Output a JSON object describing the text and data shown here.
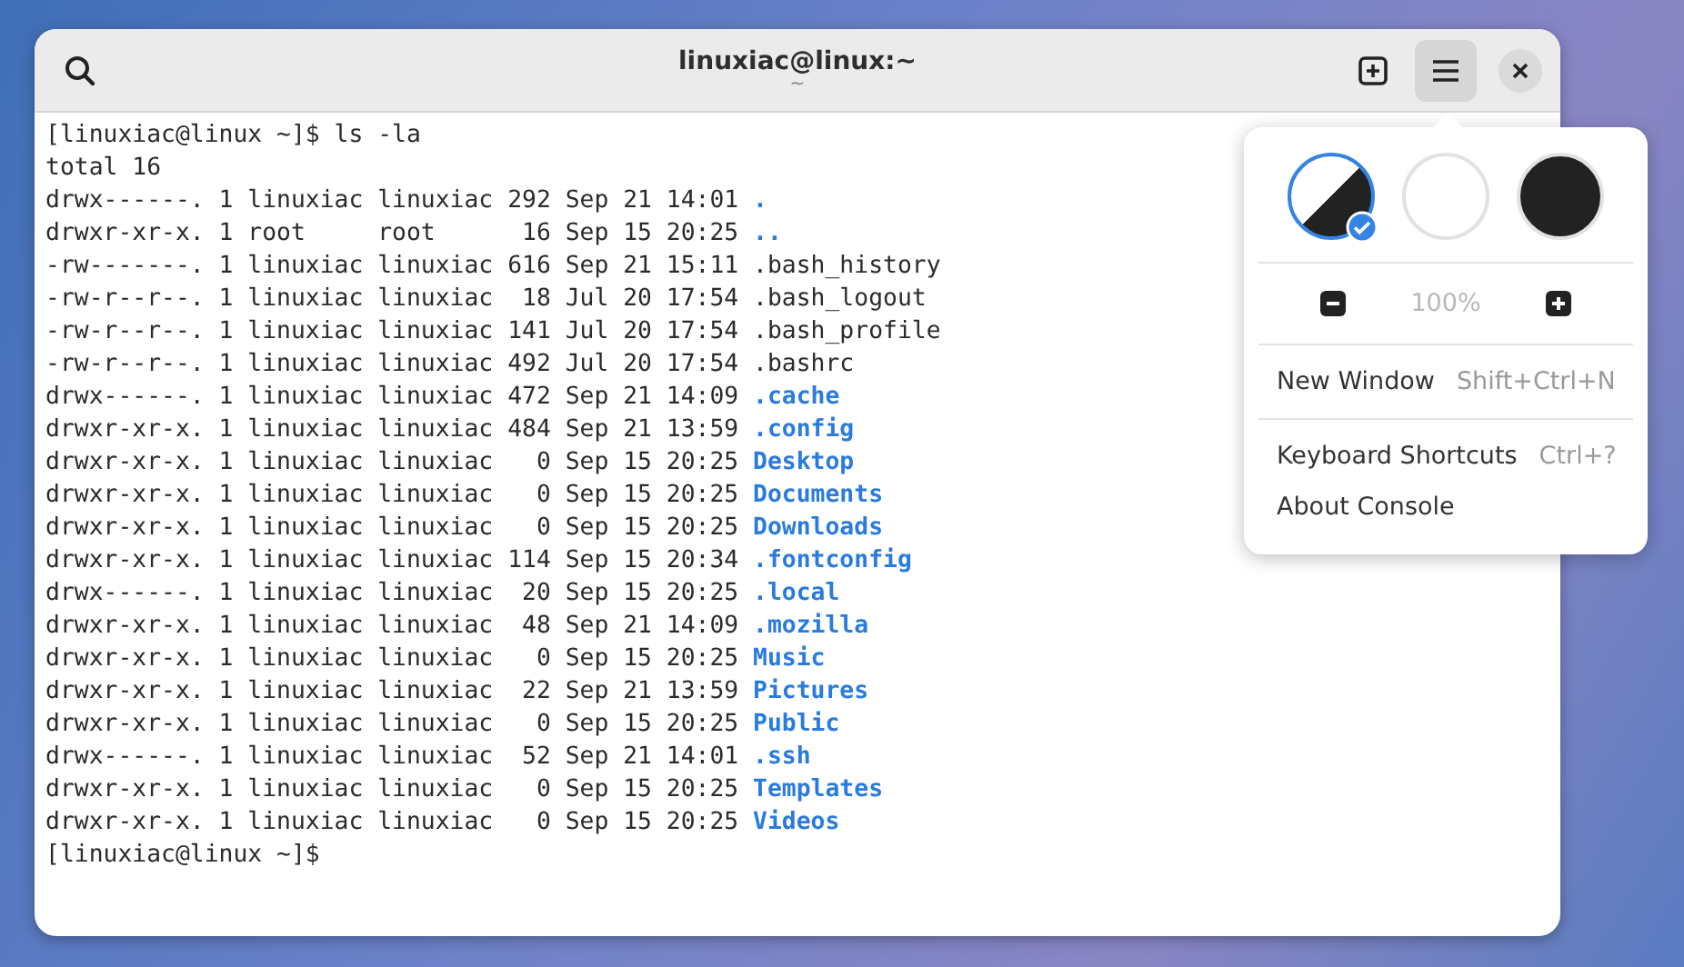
{
  "window": {
    "title": "linuxiac@linux:~",
    "subtitle": "~",
    "menu_open": true
  },
  "terminal": {
    "lines": [
      {
        "kind": "text",
        "text": "[linuxiac@linux ~]$ ls -la"
      },
      {
        "kind": "text",
        "text": "total 16"
      },
      {
        "kind": "entry",
        "info": "drwx------. 1 linuxiac linuxiac 292 Sep 21 14:01",
        "name": ".",
        "dir": true
      },
      {
        "kind": "entry",
        "info": "drwxr-xr-x. 1 root     root      16 Sep 15 20:25",
        "name": "..",
        "dir": true
      },
      {
        "kind": "entry",
        "info": "-rw-------. 1 linuxiac linuxiac 616 Sep 21 15:11",
        "name": ".bash_history",
        "dir": false
      },
      {
        "kind": "entry",
        "info": "-rw-r--r--. 1 linuxiac linuxiac  18 Jul 20 17:54",
        "name": ".bash_logout",
        "dir": false
      },
      {
        "kind": "entry",
        "info": "-rw-r--r--. 1 linuxiac linuxiac 141 Jul 20 17:54",
        "name": ".bash_profile",
        "dir": false
      },
      {
        "kind": "entry",
        "info": "-rw-r--r--. 1 linuxiac linuxiac 492 Jul 20 17:54",
        "name": ".bashrc",
        "dir": false
      },
      {
        "kind": "entry",
        "info": "drwx------. 1 linuxiac linuxiac 472 Sep 21 14:09",
        "name": ".cache",
        "dir": true
      },
      {
        "kind": "entry",
        "info": "drwxr-xr-x. 1 linuxiac linuxiac 484 Sep 21 13:59",
        "name": ".config",
        "dir": true
      },
      {
        "kind": "entry",
        "info": "drwxr-xr-x. 1 linuxiac linuxiac   0 Sep 15 20:25",
        "name": "Desktop",
        "dir": true
      },
      {
        "kind": "entry",
        "info": "drwxr-xr-x. 1 linuxiac linuxiac   0 Sep 15 20:25",
        "name": "Documents",
        "dir": true
      },
      {
        "kind": "entry",
        "info": "drwxr-xr-x. 1 linuxiac linuxiac   0 Sep 15 20:25",
        "name": "Downloads",
        "dir": true
      },
      {
        "kind": "entry",
        "info": "drwxr-xr-x. 1 linuxiac linuxiac 114 Sep 15 20:34",
        "name": ".fontconfig",
        "dir": true
      },
      {
        "kind": "entry",
        "info": "drwx------. 1 linuxiac linuxiac  20 Sep 15 20:25",
        "name": ".local",
        "dir": true
      },
      {
        "kind": "entry",
        "info": "drwxr-xr-x. 1 linuxiac linuxiac  48 Sep 21 14:09",
        "name": ".mozilla",
        "dir": true
      },
      {
        "kind": "entry",
        "info": "drwxr-xr-x. 1 linuxiac linuxiac   0 Sep 15 20:25",
        "name": "Music",
        "dir": true
      },
      {
        "kind": "entry",
        "info": "drwxr-xr-x. 1 linuxiac linuxiac  22 Sep 21 13:59",
        "name": "Pictures",
        "dir": true
      },
      {
        "kind": "entry",
        "info": "drwxr-xr-x. 1 linuxiac linuxiac   0 Sep 15 20:25",
        "name": "Public",
        "dir": true
      },
      {
        "kind": "entry",
        "info": "drwx------. 1 linuxiac linuxiac  52 Sep 21 14:01",
        "name": ".ssh",
        "dir": true
      },
      {
        "kind": "entry",
        "info": "drwxr-xr-x. 1 linuxiac linuxiac   0 Sep 15 20:25",
        "name": "Templates",
        "dir": true
      },
      {
        "kind": "entry",
        "info": "drwxr-xr-x. 1 linuxiac linuxiac   0 Sep 15 20:25",
        "name": "Videos",
        "dir": true
      },
      {
        "kind": "text",
        "text": "[linuxiac@linux ~]$"
      }
    ]
  },
  "menu": {
    "themes": [
      {
        "kind": "follow",
        "selected": true
      },
      {
        "kind": "light",
        "selected": false
      },
      {
        "kind": "dark",
        "selected": false
      }
    ],
    "zoom": {
      "value": "100%",
      "disabled": true
    },
    "sections": [
      [
        {
          "label": "New Window",
          "shortcut": "Shift+Ctrl+N"
        }
      ],
      [
        {
          "label": "Keyboard Shortcuts",
          "shortcut": "Ctrl+?"
        },
        {
          "label": "About Console"
        }
      ]
    ]
  }
}
